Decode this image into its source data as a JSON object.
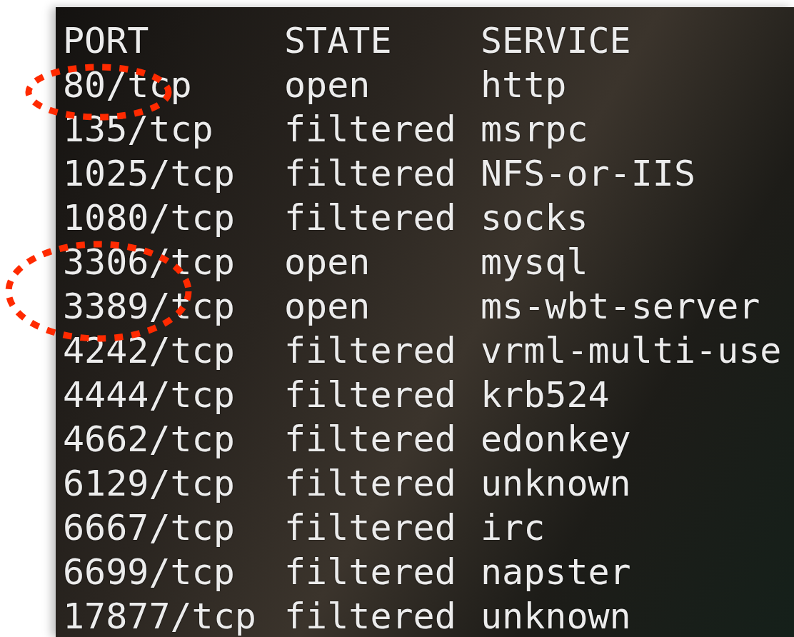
{
  "terminal": {
    "columns": [
      "PORT",
      "STATE",
      "SERVICE"
    ],
    "rows": [
      {
        "port": "80/tcp",
        "state": "open",
        "service": "http",
        "circled": true
      },
      {
        "port": "135/tcp",
        "state": "filtered",
        "service": "msrpc",
        "circled": false
      },
      {
        "port": "1025/tcp",
        "state": "filtered",
        "service": "NFS-or-IIS",
        "circled": false
      },
      {
        "port": "1080/tcp",
        "state": "filtered",
        "service": "socks",
        "circled": false
      },
      {
        "port": "3306/tcp",
        "state": "open",
        "service": "mysql",
        "circled": true
      },
      {
        "port": "3389/tcp",
        "state": "open",
        "service": "ms-wbt-server",
        "circled": true
      },
      {
        "port": "4242/tcp",
        "state": "filtered",
        "service": "vrml-multi-use",
        "circled": false
      },
      {
        "port": "4444/tcp",
        "state": "filtered",
        "service": "krb524",
        "circled": false
      },
      {
        "port": "4662/tcp",
        "state": "filtered",
        "service": "edonkey",
        "circled": false
      },
      {
        "port": "6129/tcp",
        "state": "filtered",
        "service": "unknown",
        "circled": false
      },
      {
        "port": "6667/tcp",
        "state": "filtered",
        "service": "irc",
        "circled": false
      },
      {
        "port": "6699/tcp",
        "state": "filtered",
        "service": "napster",
        "circled": false
      },
      {
        "port": "17877/tcp",
        "state": "filtered",
        "service": "unknown",
        "circled": false
      }
    ]
  }
}
